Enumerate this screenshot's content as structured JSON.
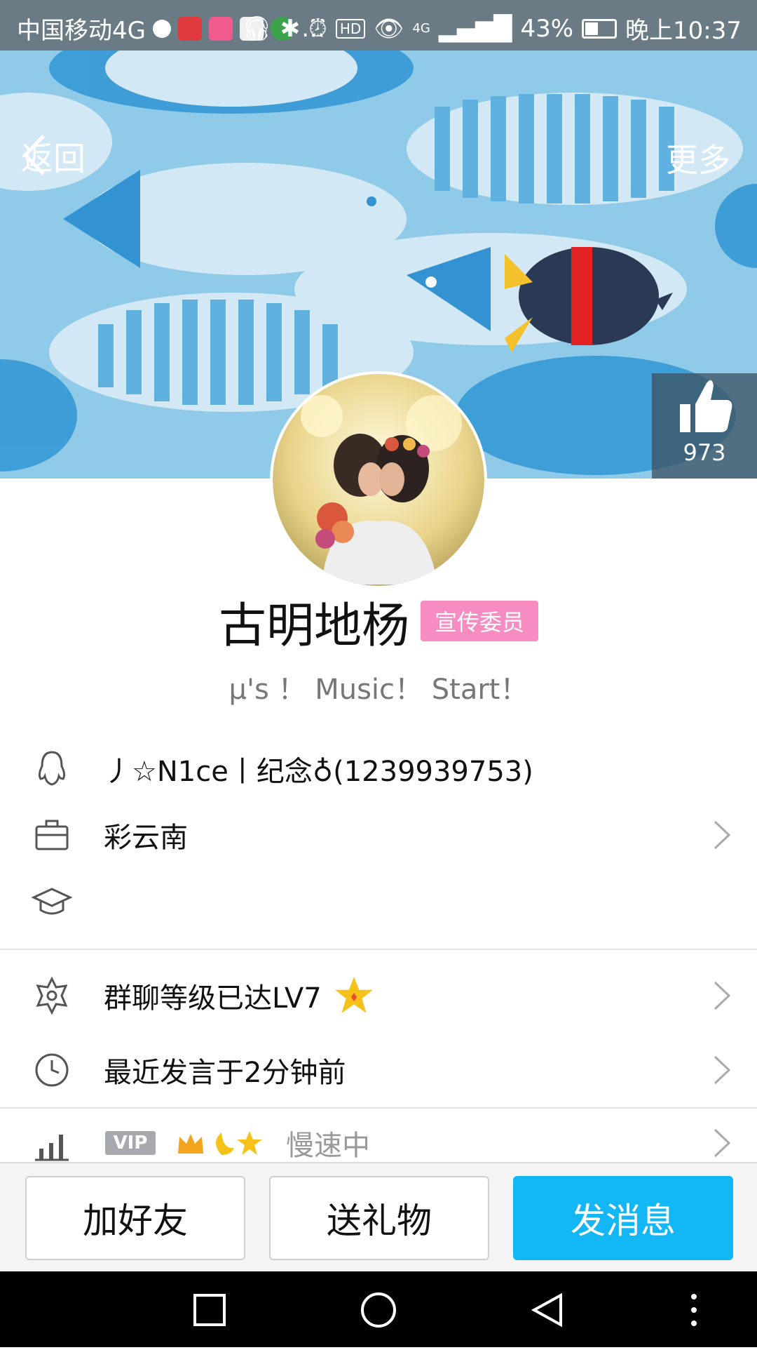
{
  "status_bar": {
    "carrier": "中国移动4G",
    "battery": "43%",
    "time": "晚上10:37",
    "hd": "HD",
    "net": "4G"
  },
  "nav": {
    "back_label": "返回",
    "more_label": "更多"
  },
  "like": {
    "count": "973"
  },
  "profile": {
    "nickname": "古明地杨",
    "badge": "宣传委员",
    "signature": "μ's ！ Music！  Start！"
  },
  "info_rows": {
    "qq": "丿☆N1ce丨纪念♁(1239939753)",
    "company": "彩云南",
    "school": ""
  },
  "group_rows": {
    "level": "群聊等级已达LV7",
    "last_speak": "最近发言于2分钟前",
    "vip_label": "VIP",
    "speed": "慢速中"
  },
  "actions": {
    "add_friend": "加好友",
    "send_gift": "送礼物",
    "send_message": "发消息"
  },
  "colors": {
    "accent": "#13b7f5",
    "badge": "#f78cc3",
    "header_bg": "#8fcbe9"
  }
}
